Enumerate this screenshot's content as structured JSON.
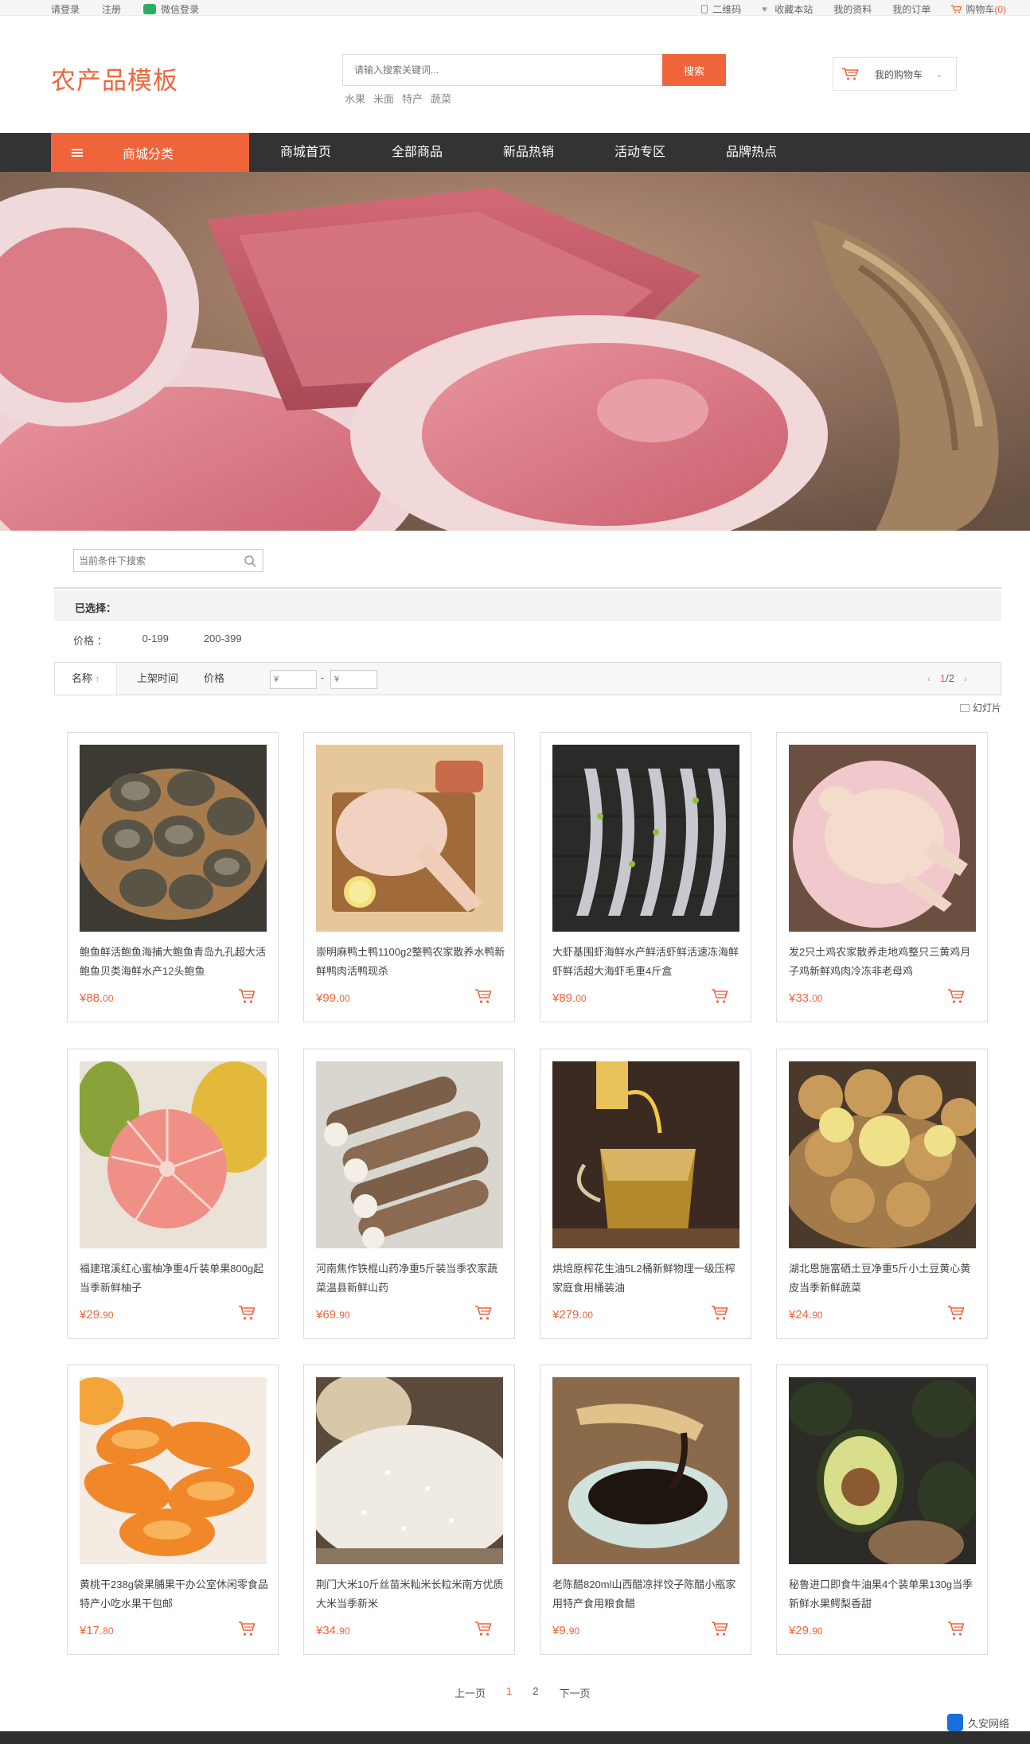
{
  "topbar": {
    "login": "请登录",
    "register": "注册",
    "wechat_login": "微信登录",
    "qrcode": "二维码",
    "favorite": "收藏本站",
    "my_profile": "我的资料",
    "my_orders": "我的订单",
    "cart_label": "购物车",
    "cart_count": "(0)"
  },
  "header": {
    "logo": "农产品模板",
    "search_placeholder": "请输入搜索关键词...",
    "search_button": "搜索",
    "hot_words": [
      "水果",
      "米面",
      "特产",
      "蔬菜"
    ],
    "my_cart": "我的购物车"
  },
  "nav": {
    "category": "商城分类",
    "items": [
      "商城首页",
      "全部商品",
      "新品热销",
      "活动专区",
      "品牌热点"
    ]
  },
  "filter": {
    "search_placeholder": "当前条件下搜索",
    "selected_label": "已选择：",
    "price_label": "价格 ：",
    "price_ranges": [
      "0-199",
      "200-399"
    ],
    "sort_name": "名称",
    "sort_time": "上架时间",
    "sort_price": "价格",
    "price_min_placeholder": "¥",
    "price_max_placeholder": "¥",
    "page_current": "1",
    "page_total": "/2",
    "slideshow": "幻灯片"
  },
  "products": [
    {
      "title": "鲍鱼鲜活鲍鱼海捕大鲍鱼青岛九孔超大活鲍鱼贝类海鲜水产12头鲍鱼",
      "price_int": "¥88.",
      "price_dec": "00"
    },
    {
      "title": "崇明麻鸭土鸭1100g2整鸭农家散养水鸭新鲜鸭肉活鸭现杀",
      "price_int": "¥99.",
      "price_dec": "00"
    },
    {
      "title": "大虾基围虾海鲜水产鲜活虾鲜活速冻海鲜虾鲜活超大海虾毛重4斤盒",
      "price_int": "¥89.",
      "price_dec": "00"
    },
    {
      "title": "发2只土鸡农家散养走地鸡整只三黄鸡月子鸡新鲜鸡肉冷冻非老母鸡",
      "price_int": "¥33.",
      "price_dec": "00"
    },
    {
      "title": "福建琯溪红心蜜柚净重4斤装单果800g起当季新鲜柚子",
      "price_int": "¥29.",
      "price_dec": "90"
    },
    {
      "title": "河南焦作铁棍山药净重5斤装当季农家蔬菜温县新鲜山药",
      "price_int": "¥69.",
      "price_dec": "90"
    },
    {
      "title": "烘焙原榨花生油5L2桶新鲜物理一级压榨家庭食用桶装油",
      "price_int": "¥279.",
      "price_dec": "00"
    },
    {
      "title": "湖北恩施富硒土豆净重5斤小土豆黄心黄皮当季新鲜蔬菜",
      "price_int": "¥24.",
      "price_dec": "90"
    },
    {
      "title": "黄桃干238g袋果脯果干办公室休闲零食品特产小吃水果干包邮",
      "price_int": "¥17.",
      "price_dec": "80"
    },
    {
      "title": "荆门大米10斤丝苗米籼米长粒米南方优质大米当季新米",
      "price_int": "¥34.",
      "price_dec": "90"
    },
    {
      "title": "老陈醋820ml山西醋凉拌饺子陈醋小瓶家用特产食用粮食醋",
      "price_int": "¥9.",
      "price_dec": "90"
    },
    {
      "title": "秘鲁进口即食牛油果4个装单果130g当季新鲜水果鳄梨香甜",
      "price_int": "¥29.",
      "price_dec": "90"
    }
  ],
  "pagination": {
    "prev": "上一页",
    "pages": [
      "1",
      "2"
    ],
    "next": "下一页"
  },
  "watermark": "久安网络",
  "colors": {
    "accent": "#f0643c",
    "nav_bg": "#333333"
  }
}
